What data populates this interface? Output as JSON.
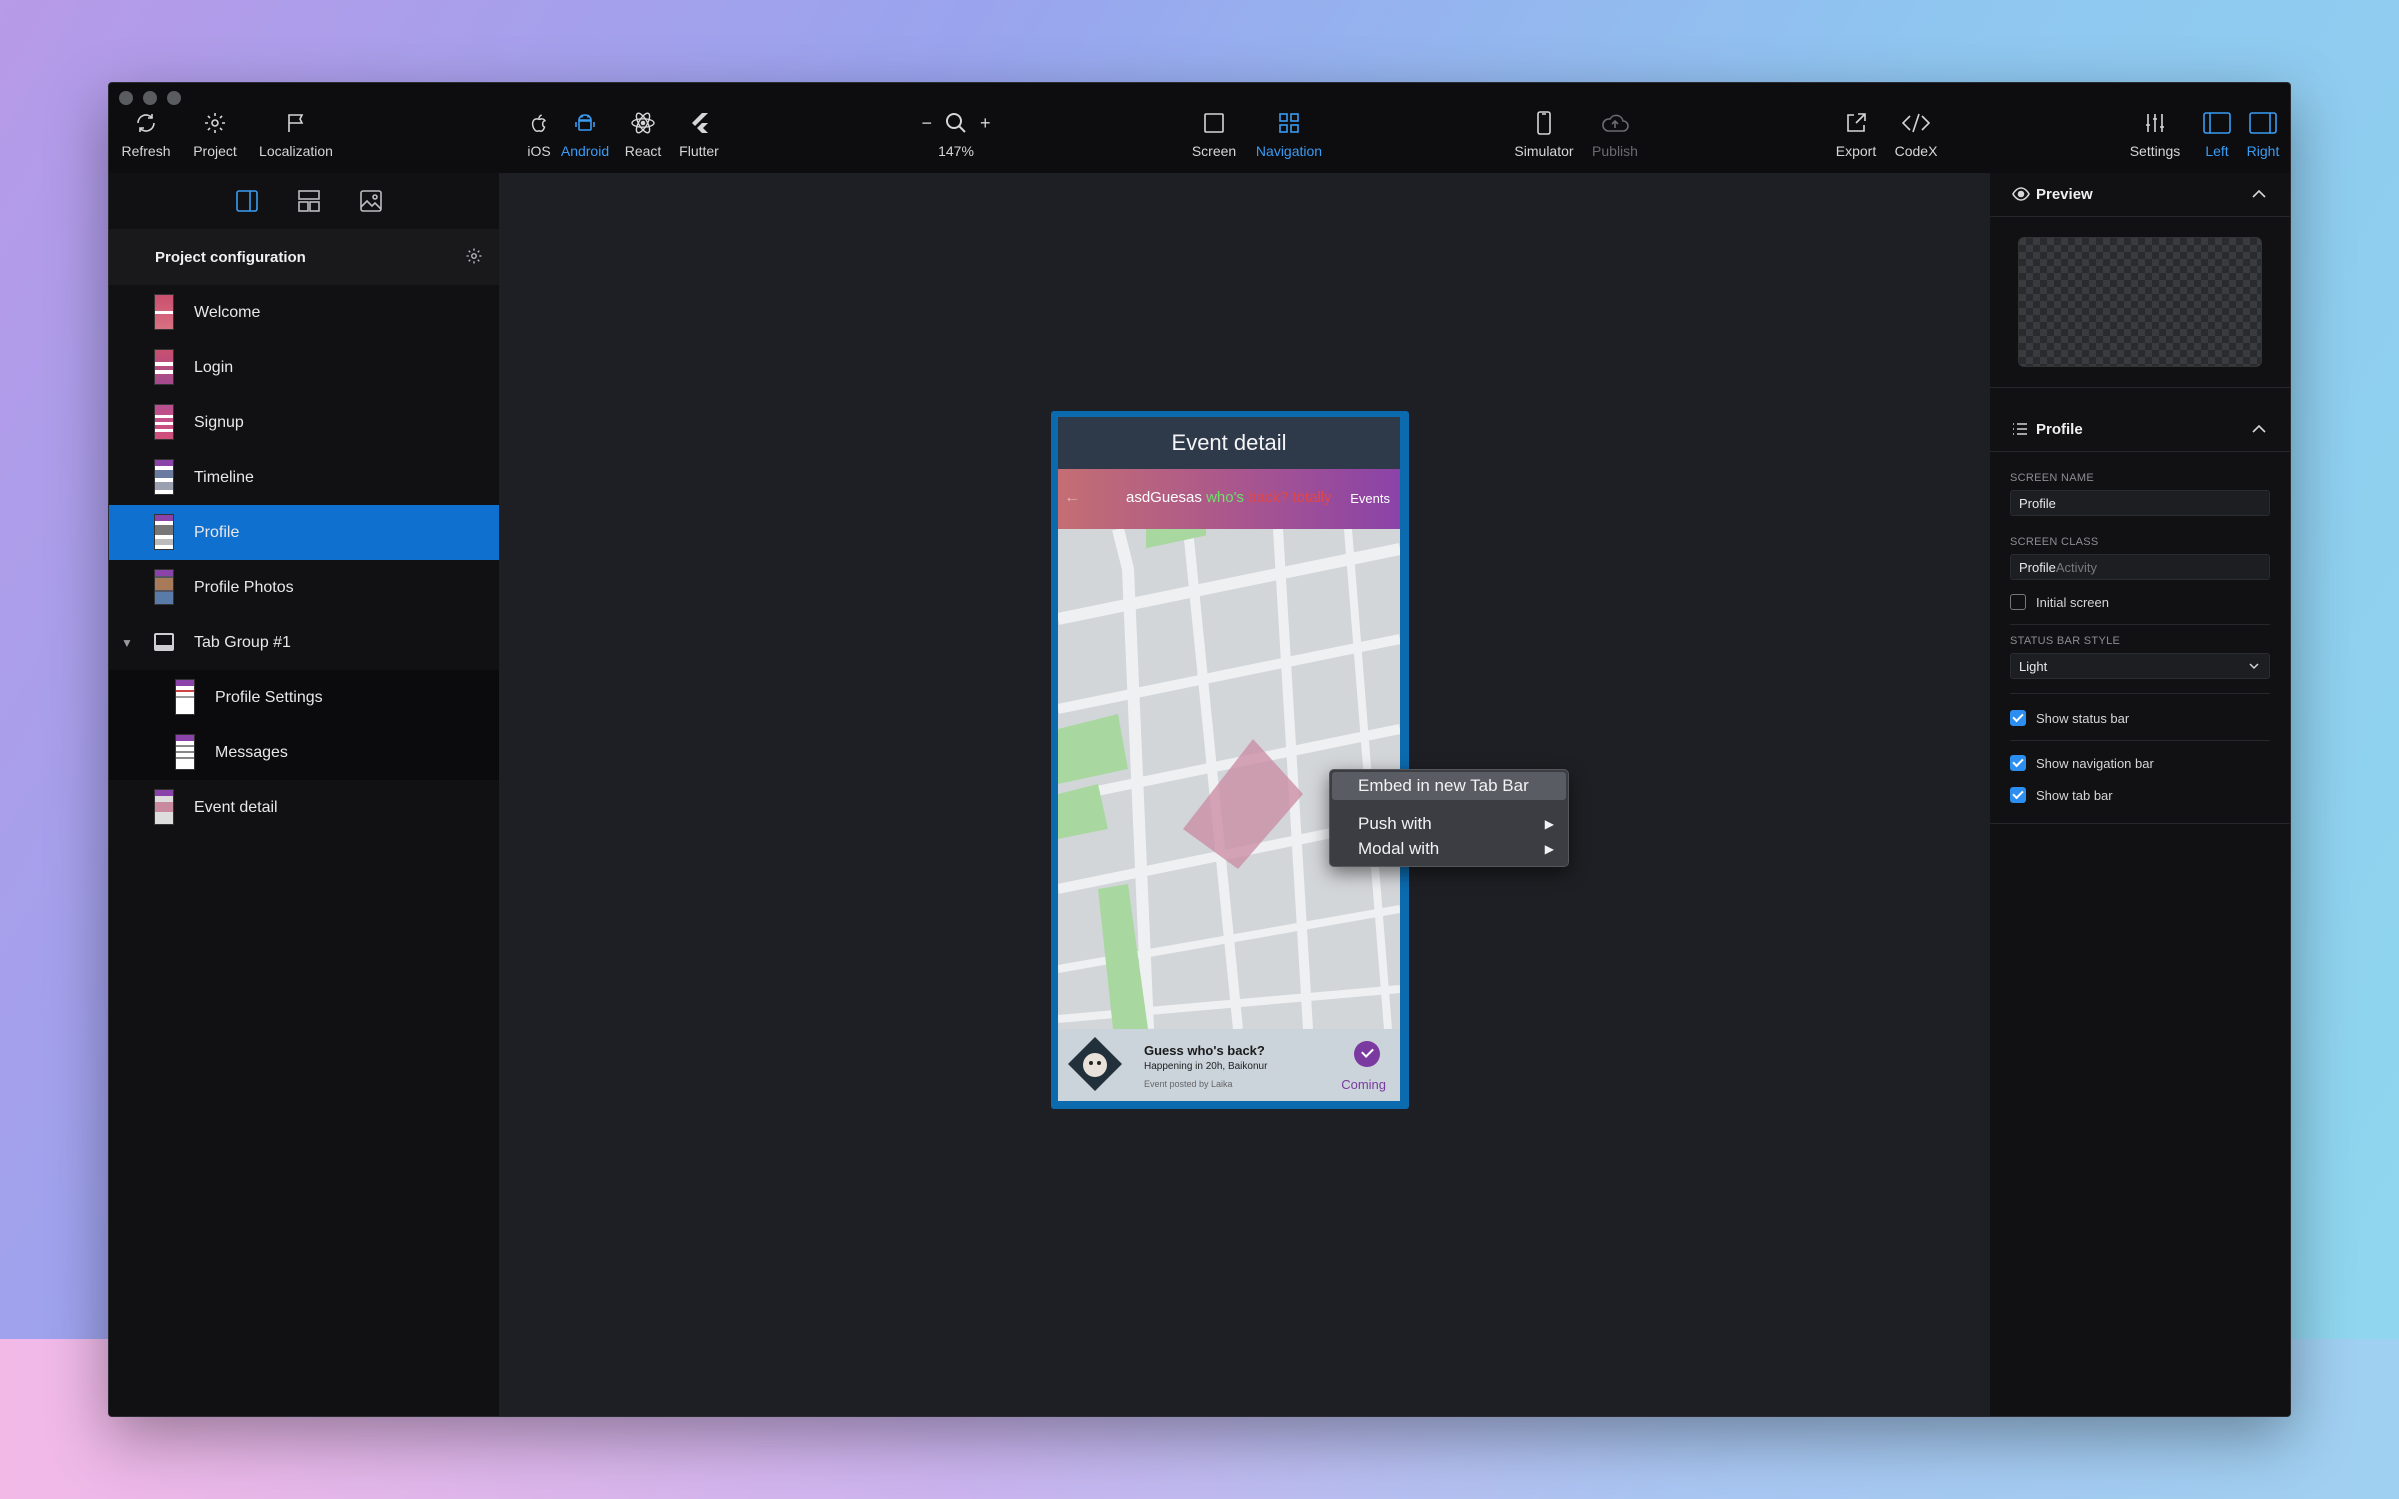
{
  "toolbar": {
    "left": [
      {
        "label": "Refresh",
        "icon": "refresh-icon"
      },
      {
        "label": "Project",
        "icon": "gear-icon"
      },
      {
        "label": "Localization",
        "icon": "flag-icon"
      }
    ],
    "platforms": [
      {
        "label": "iOS",
        "icon": "apple-icon"
      },
      {
        "label": "Android",
        "icon": "android-icon",
        "active": true
      },
      {
        "label": "React",
        "icon": "react-icon"
      },
      {
        "label": "Flutter",
        "icon": "flutter-icon"
      }
    ],
    "zoom": {
      "minus": "−",
      "plus": "+",
      "value": "147%"
    },
    "modes": [
      {
        "label": "Screen",
        "icon": "square-icon"
      },
      {
        "label": "Navigation",
        "icon": "grid-icon",
        "active": true
      }
    ],
    "simulator": "Simulator",
    "publish": "Publish",
    "export": "Export",
    "codex": "CodeX",
    "settings": "Settings",
    "left_panel": "Left",
    "right_panel": "Right"
  },
  "sidebar": {
    "header": "Project configuration",
    "items": [
      {
        "label": "Welcome"
      },
      {
        "label": "Login"
      },
      {
        "label": "Signup"
      },
      {
        "label": "Timeline"
      },
      {
        "label": "Profile",
        "selected": true
      },
      {
        "label": "Profile Photos"
      },
      {
        "label": "Tab Group #1",
        "group": true
      },
      {
        "label": "Profile Settings",
        "indent": true
      },
      {
        "label": "Messages",
        "indent": true
      },
      {
        "label": "Event detail"
      }
    ]
  },
  "phone": {
    "title": "Event detail",
    "appbar_prefix": "asdGuesas",
    "appbar_green": "who's",
    "appbar_red": "back? totally",
    "appbar_right": "Events",
    "card_title": "Guess who's back?",
    "card_subtitle": "Happening in 20h, Baikonur",
    "card_posted": "Event posted by Laika",
    "card_status": "Coming"
  },
  "context_menu": {
    "item1": "Embed in new Tab Bar",
    "item2": "Push with",
    "item3": "Modal with"
  },
  "inspector": {
    "preview_title": "Preview",
    "section_title": "Profile",
    "screen_name_label": "SCREEN NAME",
    "screen_name_value": "Profile",
    "screen_class_label": "SCREEN CLASS",
    "screen_class_value": "Profile",
    "screen_class_suffix": "Activity",
    "initial_screen": "Initial screen",
    "status_bar_style_label": "STATUS BAR STYLE",
    "status_bar_style_value": "Light",
    "show_status_bar": "Show status bar",
    "show_navigation_bar": "Show navigation bar",
    "show_tab_bar": "Show tab bar"
  },
  "colors": {
    "accent": "#1070d0",
    "active_text": "#3a9cf3"
  }
}
